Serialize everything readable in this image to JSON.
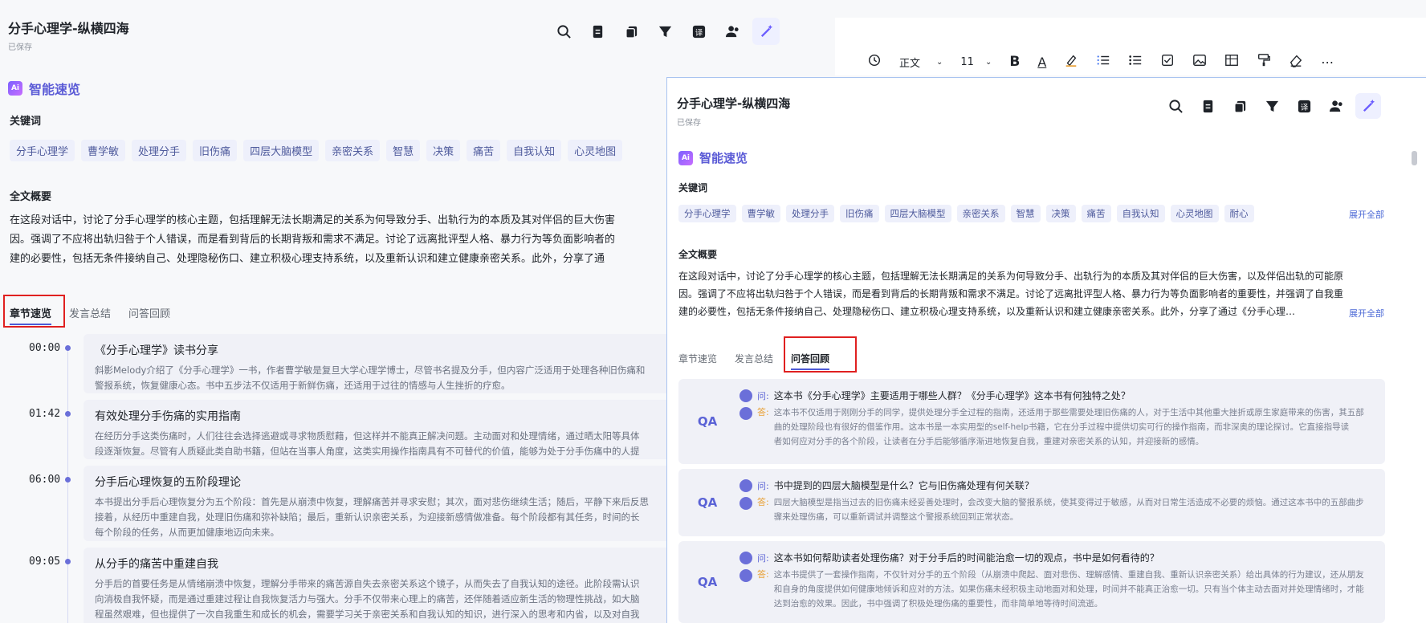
{
  "left": {
    "title": "分手心理学-纵横四海",
    "saved": "已保存",
    "brand": "智能速览",
    "keywords_title": "关键词",
    "keywords": [
      "分手心理学",
      "曹学敏",
      "处理分手",
      "旧伤痛",
      "四层大脑模型",
      "亲密关系",
      "智慧",
      "决策",
      "痛苦",
      "自我认知",
      "心灵地图"
    ],
    "summary_title": "全文概要",
    "summary_lines": [
      "在这段对话中，讨论了分手心理学的核心主题，包括理解无法长期满足的关系为何导致分手、出轨行为的本质及其对伴侣的巨大伤害",
      "因。强调了不应将出轨归咎于个人错误，而是看到背后的长期背叛和需求不满足。讨论了远离批评型人格、暴力行为等负面影响者的",
      "建的必要性，包括无条件接纳自己、处理隐秘伤口、建立积极心理支持系统，以及重新认识和建立健康亲密关系。此外，分享了通"
    ],
    "tabs": [
      "章节速览",
      "发言总结",
      "问答回顾"
    ],
    "chapters": [
      {
        "time": "00:00",
        "title": "《分手心理学》读书分享",
        "body": [
          "斜影Melody介绍了《分手心理学》一书，作者曹学敏是复旦大学心理学博士，尽管书名提及分手，但内容广泛适用于处理各种旧伤痛和",
          "警报系统，恢复健康心态。书中五步法不仅适用于新鲜伤痛，还适用于过往的情感与人生挫折的疗愈。"
        ]
      },
      {
        "time": "01:42",
        "title": "有效处理分手伤痛的实用指南",
        "body": [
          "在经历分手这类伤痛时，人们往往会选择逃避或寻求物质慰藉，但这样并不能真正解决问题。主动面对和处理情绪，通过晒太阳等具体",
          "段逐渐恢复。尽管有人质疑此类自助书籍，但站在当事人角度，这类实用操作指南具有不可替代的价值，能够为处于分手伤痛中的人提"
        ]
      },
      {
        "time": "06:00",
        "title": "分手后心理恢复的五阶段理论",
        "body": [
          "本书提出分手后心理恢复分为五个阶段：首先是从崩溃中恢复，理解痛苦并寻求安慰；其次，面对悲伤继续生活；随后，平静下来后反思",
          "接着，从经历中重建自我，处理旧伤痛和弥补缺陷；最后，重新认识亲密关系，为迎接新感情做准备。每个阶段都有其任务，时间的长",
          "每个阶段的任务，从而更加健康地迈向未来。"
        ]
      },
      {
        "time": "09:05",
        "title": "从分手的痛苦中重建自我",
        "body": [
          "分手后的首要任务是从情绪崩溃中恢复，理解分手带来的痛苦源自失去亲密关系这个镜子，从而失去了自我认知的途径。此阶段需认识",
          "向消极自我怀疑，而是通过重建过程让自我恢复活力与强大。分手不仅带来心理上的痛苦，还伴随着适应新生活的物理性挑战，如大脑",
          "程虽然艰难，但也提供了一次自我重生和成长的机会，需要学习关于亲密关系和自我认知的知识，进行深入的思考和内省，以及对自我"
        ]
      }
    ]
  },
  "toolbar": {
    "style": "正文",
    "size": "11",
    "bold": "B",
    "font_color": "A"
  },
  "right": {
    "title": "分手心理学-纵横四海",
    "saved": "已保存",
    "brand": "智能速览",
    "keywords_title": "关键词",
    "keywords": [
      "分手心理学",
      "曹学敏",
      "处理分手",
      "旧伤痛",
      "四层大脑模型",
      "亲密关系",
      "智慧",
      "决策",
      "痛苦",
      "自我认知",
      "心灵地图",
      "耐心"
    ],
    "expand_all": "展开全部",
    "summary_title": "全文概要",
    "summary_lines": [
      "在这段对话中，讨论了分手心理学的核心主题，包括理解无法长期满足的关系为何导致分手、出轨行为的本质及其对伴侣的巨大伤害，以及伴侣出轨的可能原",
      "因。强调了不应将出轨归咎于个人错误，而是看到背后的长期背叛和需求不满足。讨论了远离批评型人格、暴力行为等负面影响者的重要性，并强调了自我重",
      "建的必要性，包括无条件接纳自己、处理隐秘伤口、建立积极心理支持系统，以及重新认识和建立健康亲密关系。此外，分享了通过《分手心理…"
    ],
    "expand_summary": "展开全部",
    "tabs": [
      "章节速览",
      "发言总结",
      "问答回顾"
    ],
    "q_label": "问:",
    "a_label": "答:",
    "qa_badge": "QA",
    "qa": [
      {
        "q": "这本书《分手心理学》主要适用于哪些人群？《分手心理学》这本书有何独特之处？",
        "a": [
          "这本书不仅适用于刚刚分手的同学，提供处理分手全过程的指南，还适用于那些需要处理旧伤痛的人，对于生活中其他重大挫折或原生家庭带来的伤害，其五部",
          "曲的处理阶段也有很好的借鉴作用。这本书是一本实用型的self-help书籍，它在分手过程中提供切实可行的操作指南，而非深奥的理论探讨。它直接指导读",
          "者如何应对分手的各个阶段，让读者在分手后能够循序渐进地恢复自我，重建对亲密关系的认知，并迎接新的感情。"
        ]
      },
      {
        "q": "书中提到的四层大脑模型是什么？它与旧伤痛处理有何关联？",
        "a": [
          "四层大脑模型是指当过去的旧伤痛未经妥善处理时，会改变大脑的警报系统，使其变得过于敏感，从而对日常生活造成不必要的烦恼。通过这本书中的五部曲步",
          "骤来处理伤痛，可以重新调试并调整这个警报系统回到正常状态。"
        ]
      },
      {
        "q": "这本书如何帮助读者处理伤痛？对于分手后的时间能治愈一切的观点，书中是如何看待的？",
        "a": [
          "这本书提供了一套操作指南，不仅针对分手的五个阶段（从崩溃中爬起、面对悲伤、理解感情、重建自我、重新认识亲密关系）给出具体的行为建议，还从朋友",
          "和自身的角度提供如何健康地倾诉和应对的方法。如果伤痛未经积极主动地面对和处理，时间并不能真正治愈一切。只有当个体主动去面对并处理情绪时，才能",
          "达到治愈的效果。因此，书中强调了积极处理伤痛的重要性，而非简单地等待时间流逝。"
        ]
      }
    ]
  }
}
